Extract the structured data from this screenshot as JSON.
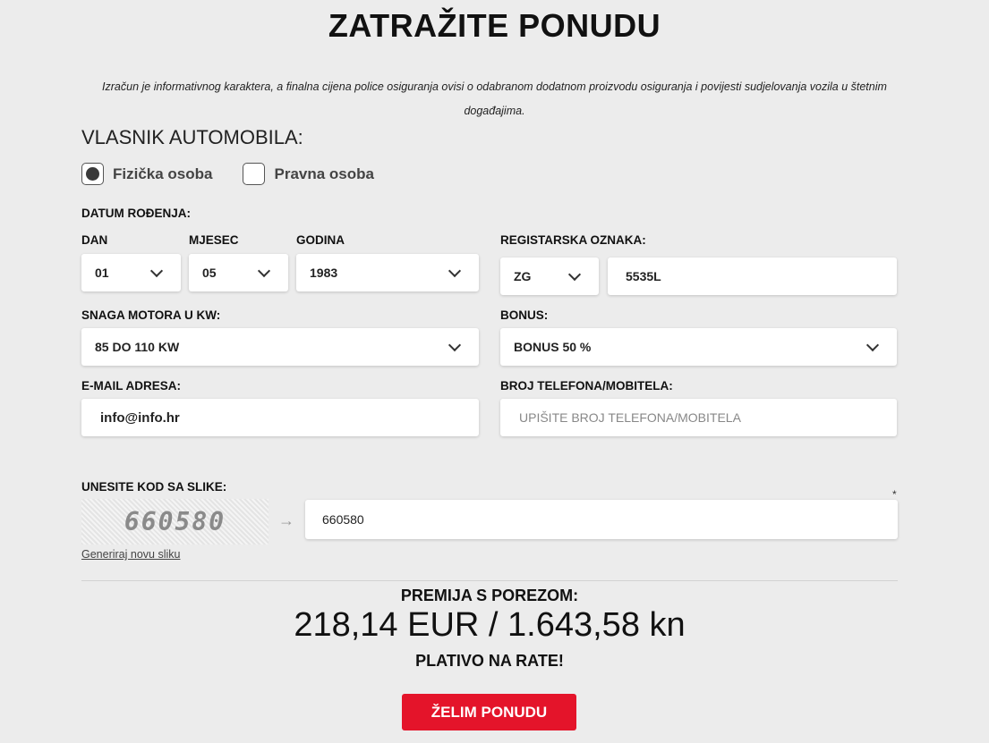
{
  "header": {
    "title": "ZATRAŽITE PONUDU",
    "disclaimer": "Izračun je informativnog karaktera, a finalna cijena police osiguranja ovisi o odabranom dodatnom proizvodu osiguranja i povijesti sudjelovanja vozila u štetnim događajima."
  },
  "owner": {
    "section_title": "VLASNIK AUTOMOBILA:",
    "options": [
      {
        "label": "Fizička osoba",
        "selected": true
      },
      {
        "label": "Pravna osoba",
        "selected": false
      }
    ]
  },
  "birth_date": {
    "label": "DATUM ROĐENJA:",
    "day": {
      "label": "DAN",
      "value": "01"
    },
    "month": {
      "label": "MJESEC",
      "value": "05"
    },
    "year": {
      "label": "GODINA",
      "value": "1983"
    }
  },
  "registration": {
    "label": "REGISTARSKA OZNAKA:",
    "city": "ZG",
    "number": "5535L"
  },
  "engine_power": {
    "label": "SNAGA MOTORA U KW:",
    "value": "85 DO 110 KW"
  },
  "bonus": {
    "label": "BONUS:",
    "value": "BONUS 50 %"
  },
  "email": {
    "label": "E-MAIL ADRESA:",
    "value": "info@info.hr"
  },
  "phone": {
    "label": "BROJ TELEFONA/MOBITELA:",
    "value": "",
    "placeholder": "UPIŠITE BROJ TELEFONA/MOBITELA"
  },
  "captcha": {
    "label": "UNESITE KOD SA SLIKE:",
    "image_text": "660580",
    "input_value": "660580",
    "regenerate": "Generiraj novu sliku",
    "required_mark": "*"
  },
  "premium": {
    "label": "PREMIJA S POREZOM:",
    "value": "218,14 EUR / 1.643,58 kn",
    "installments": "PLATIVO NA RATE!"
  },
  "submit": {
    "label": "ŽELIM PONUDU"
  },
  "colors": {
    "accent": "#e4142a",
    "background": "#ececec"
  },
  "icons": {
    "dropdown": "chevron-down-icon",
    "arrow": "arrow-right-icon"
  }
}
